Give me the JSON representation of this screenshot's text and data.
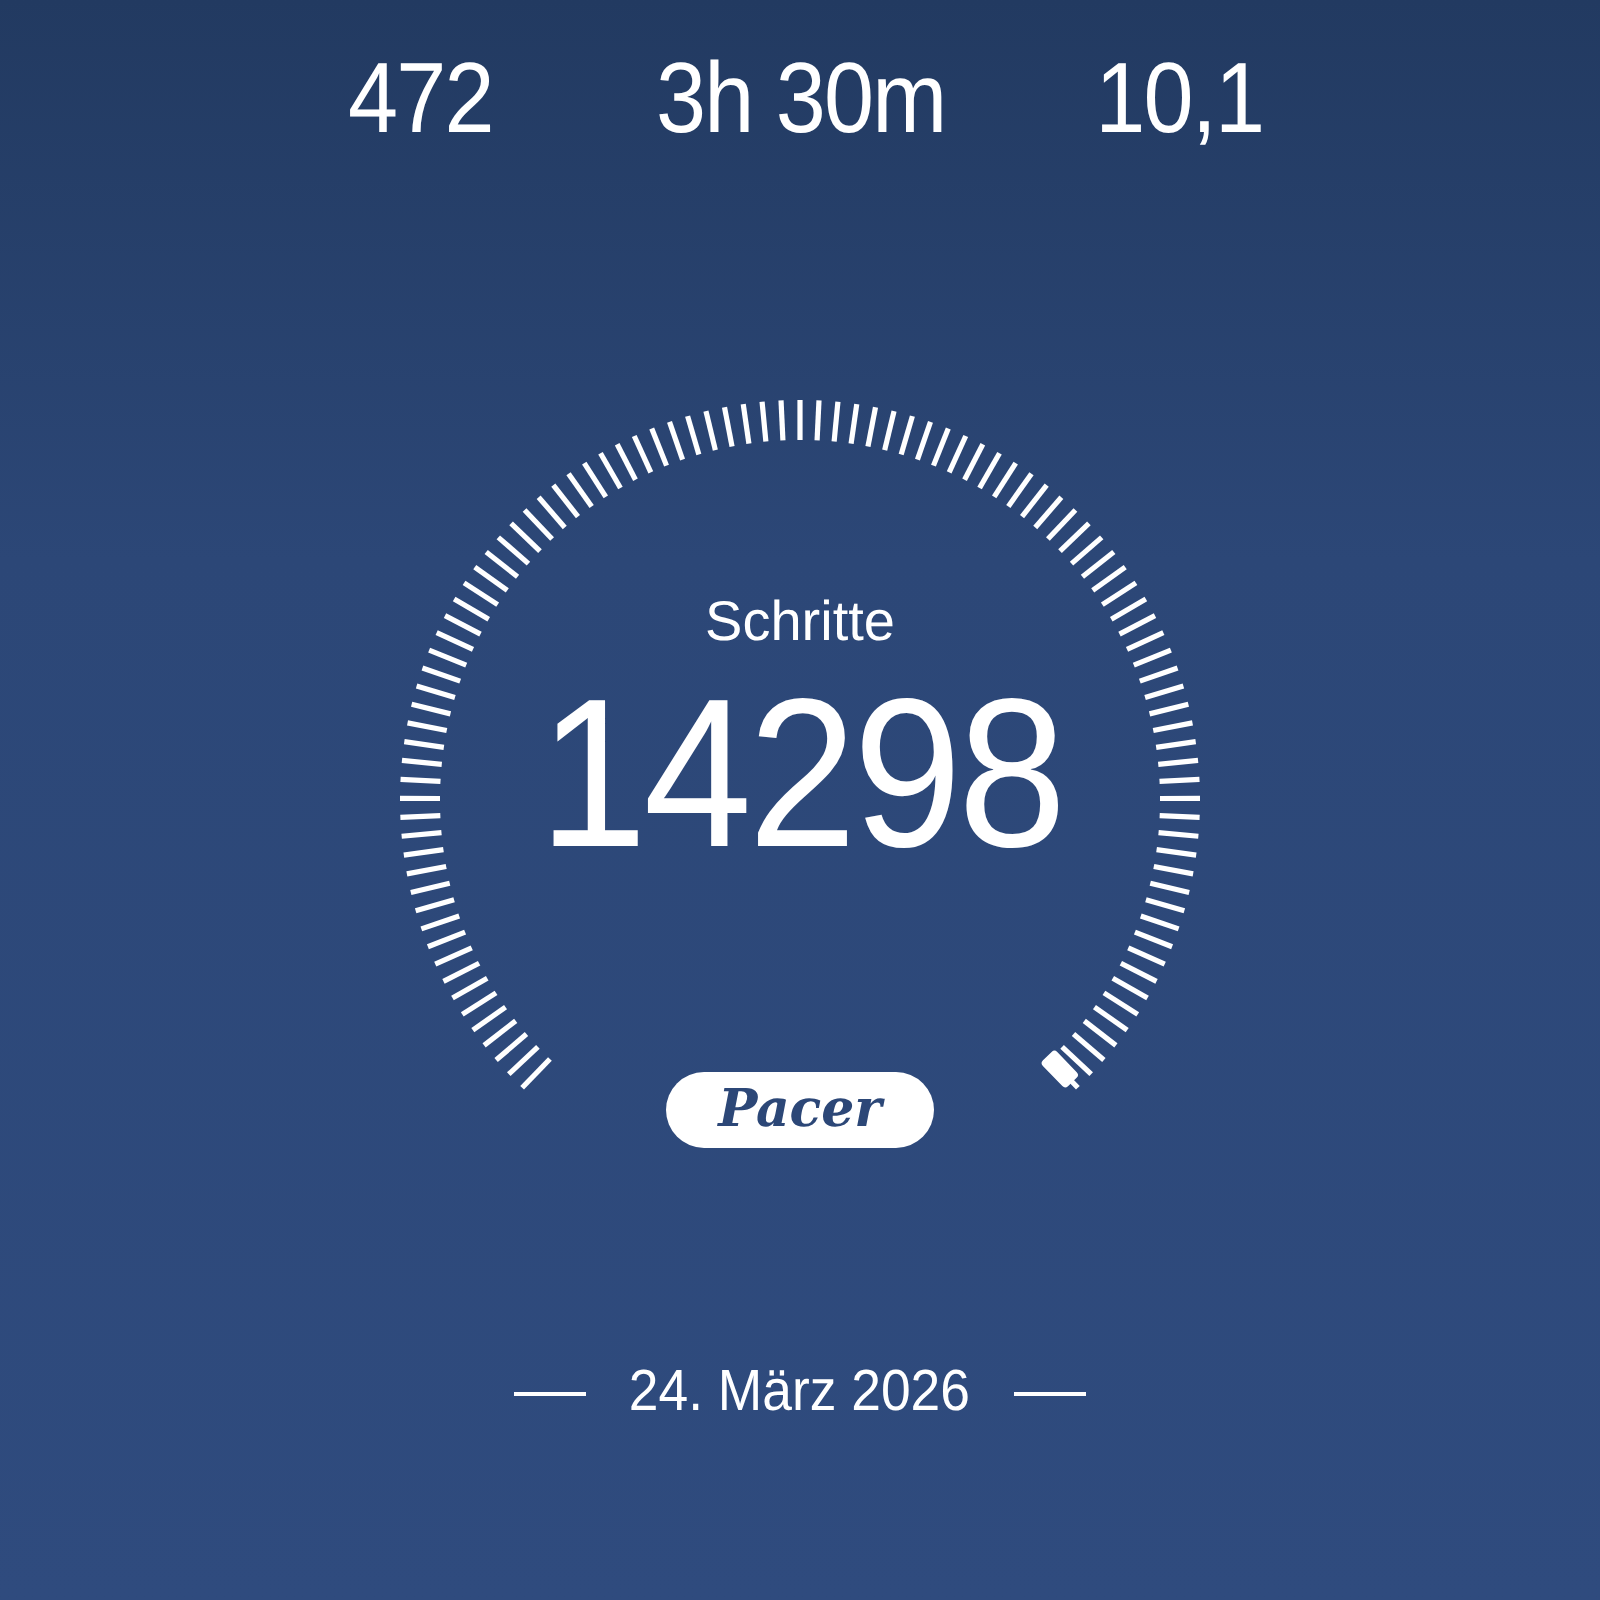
{
  "stats": [
    {
      "value": "472"
    },
    {
      "value": "3h 30m"
    },
    {
      "value": "10,1"
    }
  ],
  "gauge": {
    "label": "Schritte",
    "value": "14298",
    "logo": "Pacer"
  },
  "date": "24. März 2026"
}
